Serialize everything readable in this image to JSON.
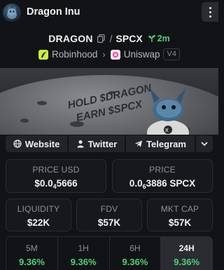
{
  "header": {
    "title": "Dragon Inu"
  },
  "pair": {
    "base": "DRAGON",
    "separator": "/",
    "quote": "SPCX",
    "age": "2m"
  },
  "chain": {
    "network": "Robinhood",
    "dex": "Uniswap",
    "version": "V4"
  },
  "banner": {
    "line1": "HOLD $DRAGON",
    "line2": "EARN $SPCX"
  },
  "links": {
    "website": "Website",
    "twitter": "Twitter",
    "telegram": "Telegram"
  },
  "price_usd": {
    "label": "PRICE USD",
    "prefix": "$0.0",
    "zeros": "4",
    "digits": "5666"
  },
  "price_native": {
    "label": "PRICE",
    "prefix": "0.0",
    "zeros": "6",
    "digits": "3886 SPCX"
  },
  "liquidity": {
    "label": "LIQUIDITY",
    "value": "$22K"
  },
  "fdv": {
    "label": "FDV",
    "value": "$57K"
  },
  "mkt_cap": {
    "label": "MKT CAP",
    "value": "$57K"
  },
  "changes": [
    {
      "label": "5M",
      "value": "9.36%"
    },
    {
      "label": "1H",
      "value": "9.36%"
    },
    {
      "label": "6H",
      "value": "9.36%"
    },
    {
      "label": "24H",
      "value": "9.36%"
    }
  ],
  "colors": {
    "accent_green": "#4fd17a",
    "background": "#121316",
    "panel": "#22242a"
  }
}
